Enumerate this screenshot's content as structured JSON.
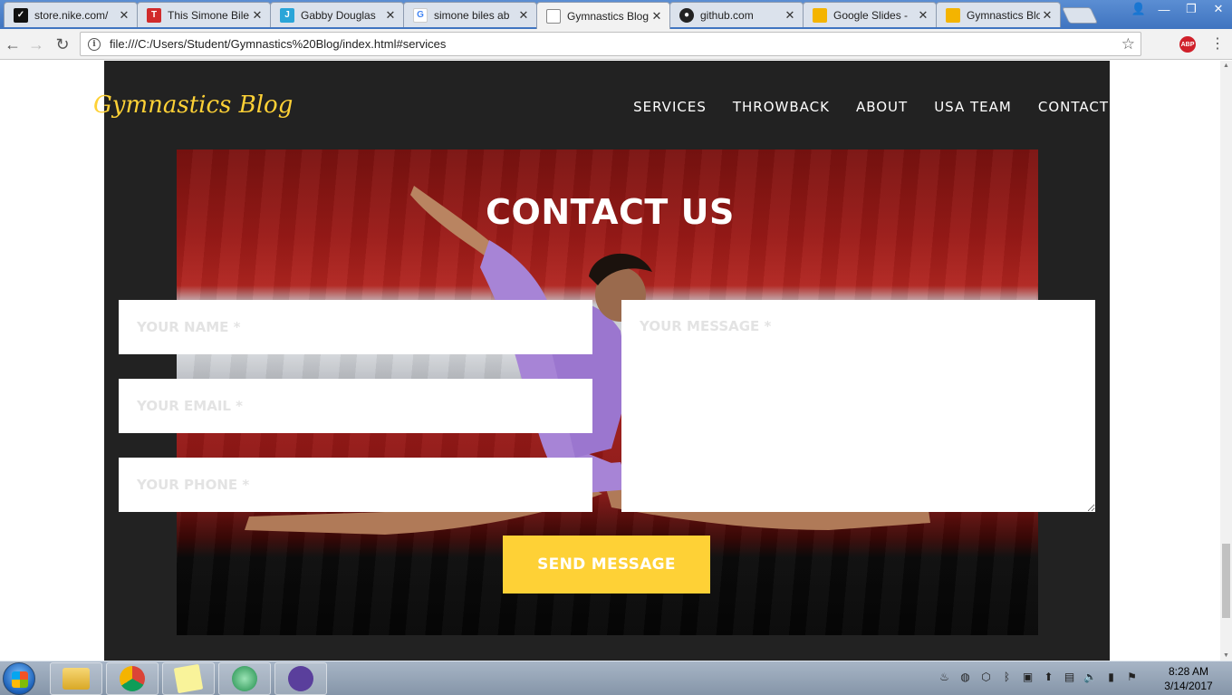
{
  "browser": {
    "tabs": [
      {
        "title": "store.nike.com/",
        "favicon": "nike-icon",
        "color": "#111111"
      },
      {
        "title": "This Simone Bile",
        "favicon": "t-logo-icon",
        "color": "#d12b2b"
      },
      {
        "title": "Gabby Douglas",
        "favicon": "j-icon",
        "color": "#2aa5d8"
      },
      {
        "title": "simone biles ab",
        "favicon": "google-icon",
        "color": "#4285f4"
      },
      {
        "title": "Gymnastics Blog",
        "favicon": "page-icon",
        "color": "#777777"
      },
      {
        "title": "github.com",
        "favicon": "github-icon",
        "color": "#222222"
      },
      {
        "title": "Google Slides -",
        "favicon": "slides-icon",
        "color": "#f4b400"
      },
      {
        "title": "Gymnastics Blog",
        "favicon": "slides-icon",
        "color": "#f4b400"
      }
    ],
    "active_tab": 4,
    "url": "file:///C:/Users/Student/Gymnastics%20Blog/index.html#services",
    "extension_label": "ABP"
  },
  "site": {
    "logo": "Gymnastics Blog",
    "nav": [
      "SERVICES",
      "THROWBACK",
      "ABOUT",
      "USA TEAM",
      "CONTACT"
    ],
    "contact_title": "CONTACT US",
    "form": {
      "name_placeholder": "YOUR NAME *",
      "email_placeholder": "YOUR EMAIL *",
      "phone_placeholder": "YOUR PHONE *",
      "message_placeholder": "YOUR MESSAGE *",
      "submit_label": "SEND MESSAGE"
    },
    "colors": {
      "accent": "#fed136",
      "background": "#222222"
    }
  },
  "taskbar": {
    "apps": [
      "file-explorer-icon",
      "chrome-icon",
      "sticky-notes-icon",
      "atom-icon",
      "app-icon"
    ],
    "time": "8:28 AM",
    "date": "3/14/2017"
  }
}
